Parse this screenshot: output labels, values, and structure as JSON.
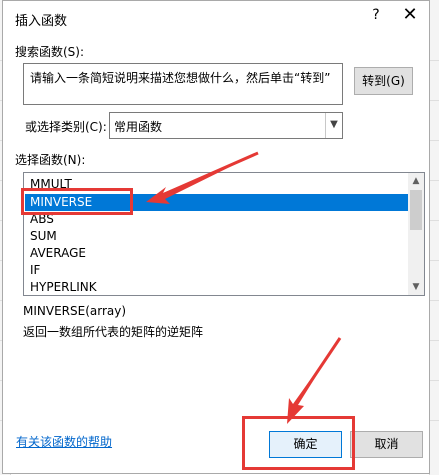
{
  "dialog": {
    "title": "插入函数",
    "help_icon": "?",
    "close_icon": "✕"
  },
  "search": {
    "label": "搜索函数(S):",
    "text": "请输入一条简短说明来描述您想做什么，然后单击“转到”",
    "go_button": "转到(G)"
  },
  "category": {
    "label": "或选择类别(C):",
    "value": "常用函数"
  },
  "functions": {
    "label": "选择函数(N):",
    "items": [
      "MMULT",
      "MINVERSE",
      "ABS",
      "SUM",
      "AVERAGE",
      "IF",
      "HYPERLINK"
    ],
    "selected": "MINVERSE"
  },
  "details": {
    "signature": "MINVERSE(array)",
    "description": "返回一数组所代表的矩阵的逆矩阵"
  },
  "footer": {
    "help_link": "有关该函数的帮助",
    "ok_button": "确定",
    "cancel_button": "取消"
  },
  "colors": {
    "annotation": "#e53935",
    "selection": "#0078d7",
    "link": "#0066cc"
  }
}
